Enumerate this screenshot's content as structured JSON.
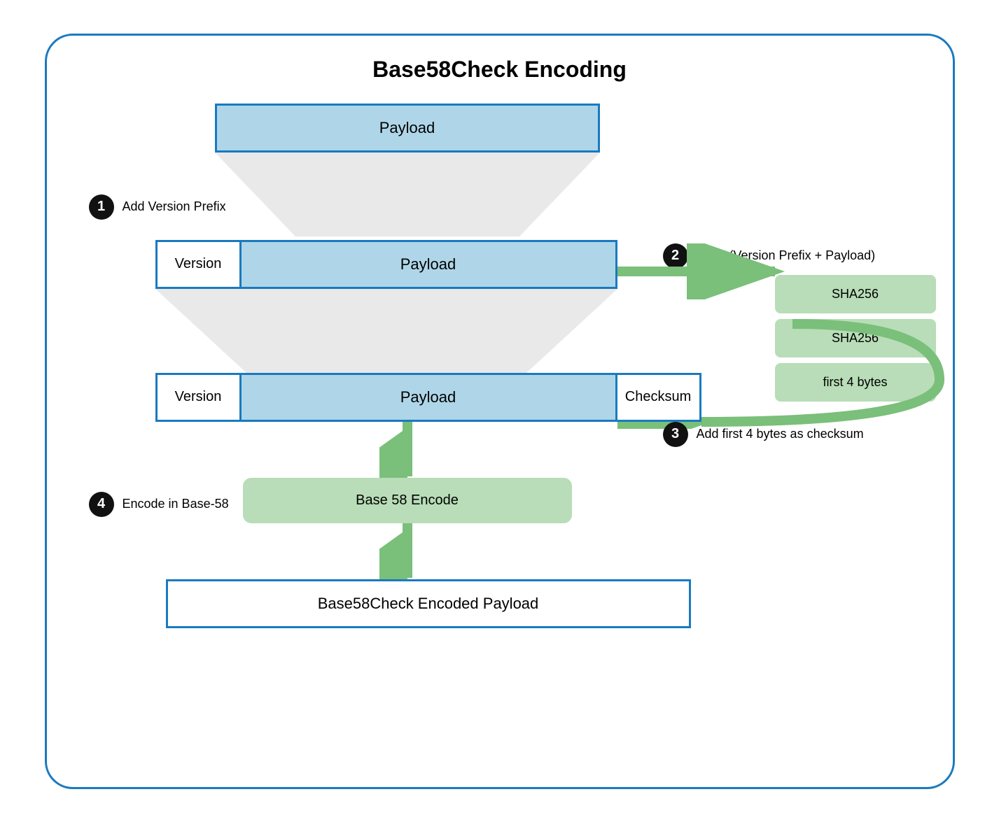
{
  "title": "Base58Check Encoding",
  "boxes": {
    "payload_top": "Payload",
    "version": "Version",
    "payload_mid": "Payload",
    "payload_bot": "Payload",
    "checksum": "Checksum",
    "sha256_1": "SHA256",
    "sha256_2": "SHA256",
    "first_4_bytes": "first 4 bytes",
    "base58_encode": "Base 58 Encode",
    "final": "Base58Check Encoded Payload"
  },
  "steps": {
    "step1": "1",
    "step1_label": "Add Version Prefix",
    "step2": "2",
    "step2_label": "Hash (Version Prefix + Payload)",
    "step3": "3",
    "step3_label": "Add first 4 bytes as checksum",
    "step4": "4",
    "step4_label": "Encode in Base-58"
  },
  "colors": {
    "blue_border": "#1a7abf",
    "blue_fill": "#aed6e8",
    "green_fill": "#b8ddb8",
    "dark": "#111",
    "white": "#fff"
  }
}
